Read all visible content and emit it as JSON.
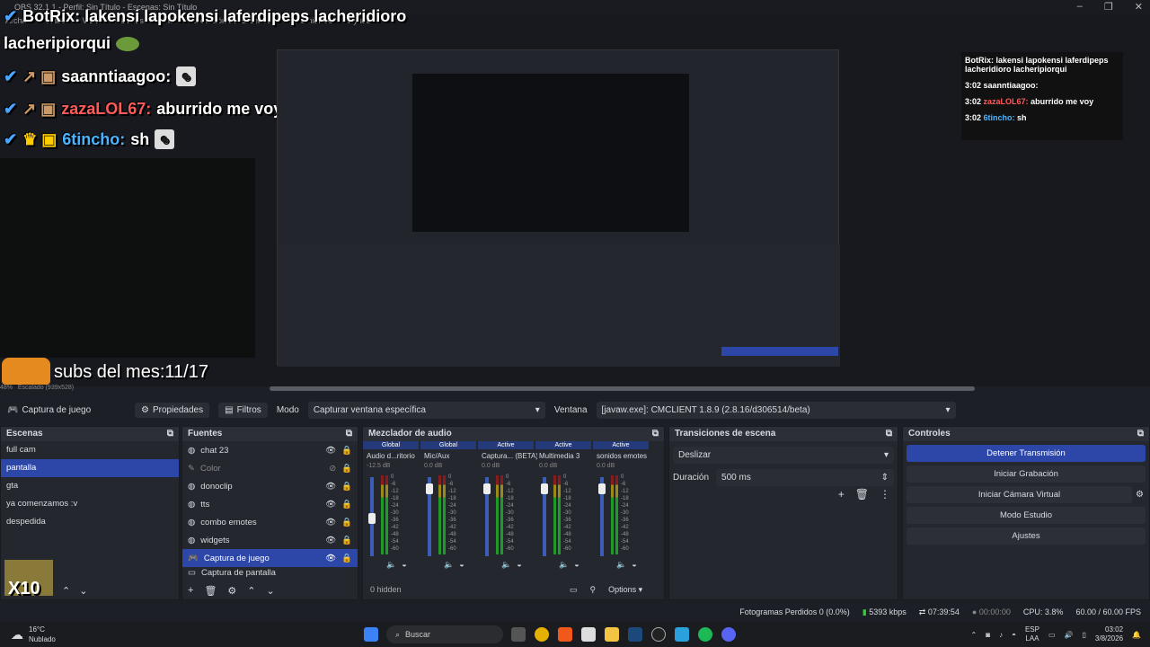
{
  "window": {
    "title": "OBS 32.1.1 - Perfil: Sin Título - Escenas: Sin Título"
  },
  "menu": [
    "Archivo",
    "Editar",
    "Vista",
    "Paneles",
    "Perfil",
    "Colección de Escenas",
    "Herramientas",
    "Ayuda"
  ],
  "overlay_chat": {
    "header": "BotRix: lakensi lapokensi laferdipeps lacheridioro",
    "header_cont": "lacheripiorqui",
    "lines": [
      {
        "user": "saanntiaagoo:",
        "msg": ""
      },
      {
        "user": "zazaLOL67:",
        "msg": "aburrido me voy"
      },
      {
        "user": "6tincho:",
        "msg": "sh"
      }
    ],
    "subs": "subs del mes:11/17",
    "multiplier": "X10"
  },
  "right_chat": {
    "header": "BotRix: lakensi lapokensi laferdipeps lacheridioro lacheripiorqui",
    "lines": [
      {
        "time": "3:02",
        "user": "saanntiaagoo:",
        "msg": ""
      },
      {
        "time": "3:02",
        "user": "zazaLOL67:",
        "msg": "aburrido me voy"
      },
      {
        "time": "3:02",
        "user": "6tincho:",
        "msg": "sh"
      }
    ]
  },
  "zoom": {
    "level": "48%",
    "scale": "Escalado (939x528)"
  },
  "source_toolbar": {
    "source": "Captura de juego",
    "properties": "Propiedades",
    "filters": "Filtros",
    "mode_label": "Modo",
    "mode_value": "Capturar ventana específica",
    "window_label": "Ventana",
    "window_value": "[javaw.exe]: CMCLIENT 1.8.9 (2.8.16/d306514/beta)"
  },
  "scenes": {
    "title": "Escenas",
    "items": [
      "full cam",
      "pantalla",
      "gta",
      "ya comenzamos :v",
      "despedida"
    ],
    "selected": 1
  },
  "sources": {
    "title": "Fuentes",
    "items": [
      "chat 23",
      "Color",
      "donoclip",
      "tts",
      "combo emotes",
      "widgets",
      "Captura de juego",
      "Captura de pantalla"
    ],
    "selected": 6
  },
  "mixer": {
    "title": "Mezclador de audio",
    "tags": [
      "Global",
      "Global",
      "Active",
      "Active",
      "Active"
    ],
    "channels": [
      {
        "name": "Audio d...ritorio",
        "db": "-12.5 dB",
        "level": 0.55
      },
      {
        "name": "Mic/Aux",
        "db": "0.0 dB",
        "level": 0.92
      },
      {
        "name": "Captura... (BETA)",
        "db": "0.0 dB",
        "level": 0.92
      },
      {
        "name": "Multimedia 3",
        "db": "0.0 dB",
        "level": 0.92
      },
      {
        "name": "sonidos emotes",
        "db": "0.0 dB",
        "level": 0.92
      }
    ],
    "scale": [
      "0",
      "-6",
      "-12",
      "-18",
      "-24",
      "-30",
      "-36",
      "-42",
      "-48",
      "-54",
      "-60"
    ],
    "hidden": "0 hidden",
    "options": "Options"
  },
  "transitions": {
    "title": "Transiciones de escena",
    "type": "Deslizar",
    "duration_label": "Duración",
    "duration_value": "500 ms"
  },
  "controls": {
    "title": "Controles",
    "buttons": [
      "Detener Transmisión",
      "Iniciar Grabación",
      "Iniciar Cámara Virtual",
      "Modo Estudio",
      "Ajustes"
    ]
  },
  "status": {
    "dropped": "Fotogramas Perdidos 0 (0.0%)",
    "bitrate": "5393 kbps",
    "stream_time": "07:39:54",
    "rec_time": "00:00:00",
    "cpu": "CPU: 3.8%",
    "fps": "60.00 / 60.00 FPS"
  },
  "taskbar": {
    "weather_temp": "16°C",
    "weather_desc": "Nublado",
    "search": "Buscar",
    "lang": "ESP",
    "lang2": "LAA",
    "time": "03:02",
    "date": "3/8/2026"
  },
  "colors": {
    "accent": "#2c47a8",
    "panel": "#25272f",
    "bg": "#1d1f26"
  }
}
